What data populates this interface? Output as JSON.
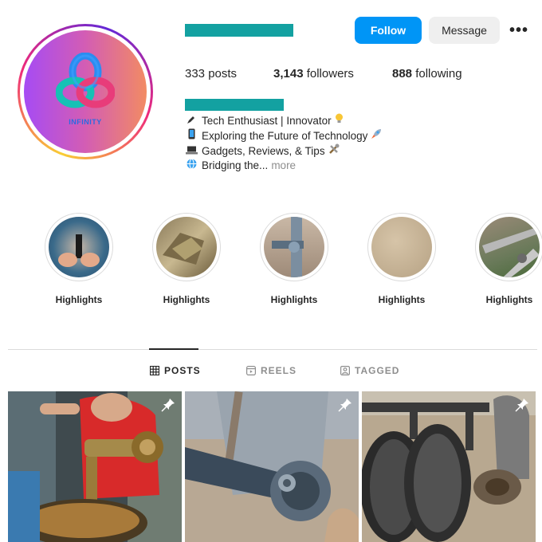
{
  "profile": {
    "avatar_logo_text": "INFINITY",
    "follow_label": "Follow",
    "message_label": "Message",
    "more_label": "•••"
  },
  "stats": {
    "posts_count": "333",
    "posts_label": "posts",
    "followers_count": "3,143",
    "followers_label": "followers",
    "following_count": "888",
    "following_label": "following"
  },
  "bio": {
    "lines": [
      {
        "icon": "pen-icon",
        "text": "Tech Enthusiast | Innovator",
        "trail_icon": "lightbulb-icon"
      },
      {
        "icon": "phone-icon",
        "text": "Exploring the Future of Technology",
        "trail_icon": "rocket-icon"
      },
      {
        "icon": "laptop-icon",
        "text": "Gadgets, Reviews, & Tips",
        "trail_icon": "tools-icon"
      },
      {
        "icon": "globe-icon",
        "text": "Bridging the...",
        "trail_icon": ""
      }
    ],
    "more_label": "more"
  },
  "highlights": [
    {
      "label": "Highlights"
    },
    {
      "label": "Highlights"
    },
    {
      "label": "Highlights"
    },
    {
      "label": "Highlights"
    },
    {
      "label": "Highlights"
    }
  ],
  "tabs": [
    {
      "label": "POSTS",
      "active": true
    },
    {
      "label": "REELS",
      "active": false
    },
    {
      "label": "TAGGED",
      "active": false
    }
  ],
  "colors": {
    "accent": "#0095f6",
    "redaction": "#13a1a1"
  }
}
